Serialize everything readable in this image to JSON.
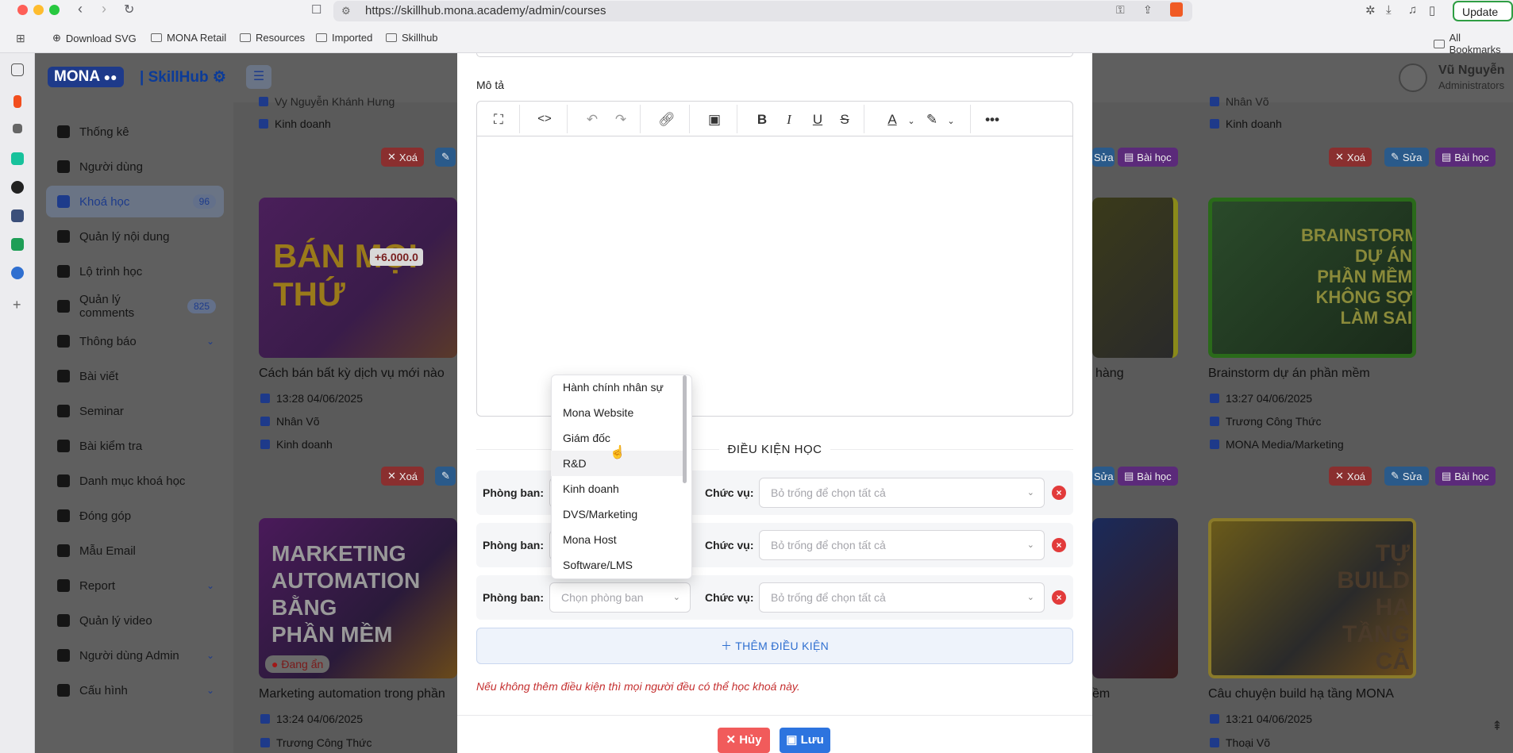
{
  "browser": {
    "url": "https://skillhub.mona.academy/admin/courses",
    "update_label": "Update",
    "bookmarks": [
      "Download SVG",
      "MONA Retail",
      "Resources",
      "Imported",
      "Skillhub"
    ],
    "all_bookmarks": "All Bookmarks"
  },
  "logo": {
    "brand": "MONA",
    "product": "SkillHub"
  },
  "user": {
    "name": "Vũ Nguyễn",
    "role": "Administrators"
  },
  "sidebar": {
    "items": [
      {
        "label": "Thống kê"
      },
      {
        "label": "Người dùng"
      },
      {
        "label": "Khoá học",
        "badge": "96",
        "active": true
      },
      {
        "label": "Quản lý nội dung"
      },
      {
        "label": "Lộ trình học"
      },
      {
        "label": "Quản lý comments",
        "badge": "825"
      },
      {
        "label": "Thông báo",
        "expandable": true
      },
      {
        "label": "Bài viết"
      },
      {
        "label": "Seminar"
      },
      {
        "label": "Bài kiểm tra"
      },
      {
        "label": "Danh mục khoá học"
      },
      {
        "label": "Đóng góp"
      },
      {
        "label": "Mẫu Email"
      },
      {
        "label": "Report",
        "expandable": true
      },
      {
        "label": "Quản lý video"
      },
      {
        "label": "Người dùng Admin",
        "expandable": true
      },
      {
        "label": "Cấu hình",
        "expandable": true
      }
    ]
  },
  "cards": {
    "top_left": {
      "author": "Vy Nguyễn Khánh Hưng",
      "dept": "Kinh doanh"
    },
    "top_right_a": {
      "author": "Nhân Võ",
      "dept": "Kinh doanh"
    },
    "left_1": {
      "title": "Cách bán bất kỳ dịch vụ mới nào",
      "time": "13:28 04/06/2025",
      "author": "Nhân Võ",
      "dept": "Kinh doanh",
      "thumb_text": "BÁN MỌI THỨ",
      "thumb_price": "+6.000.0"
    },
    "mid_1": {
      "title": "hàng"
    },
    "right_1": {
      "title": "Brainstorm dự án phần mềm",
      "time": "13:27 04/06/2025",
      "author": "Trương Công Thức",
      "dept": "MONA Media/Marketing",
      "thumb_text": "BRAINSTORM DỰ ÁN PHẦN MỀM KHÔNG SỢ LÀM SAI"
    },
    "left_2": {
      "title": "Marketing automation trong phần",
      "time": "13:24 04/06/2025",
      "author": "Trương Công Thức",
      "status": "Đang ẩn",
      "thumb_text": "MARKETING AUTOMATION BẰNG PHẦN MỀM"
    },
    "mid_2": {
      "title": "ềm"
    },
    "right_2": {
      "title": "Câu chuyện build hạ tầng MONA",
      "time": "13:21 04/06/2025",
      "author": "Thoại Võ",
      "thumb_text": "TỰ BUILD HẠ TẦNG CẢ CHỤC TỶ"
    },
    "buttons": {
      "delete": "Xoá",
      "edit": "Sửa",
      "lessons": "Bài học"
    }
  },
  "modal": {
    "description_label": "Mô tả",
    "section_title": "ĐIỀU KIỆN HỌC",
    "dept_label": "Phòng ban:",
    "position_label": "Chức vụ:",
    "position_placeholder": "Bỏ trống để chọn tất cả",
    "dept_placeholder": "Chọn phòng ban",
    "add_condition": "THÊM ĐIỀU KIỆN",
    "note": "Nếu không thêm điều kiện thì mọi người đều có thể học khoá này.",
    "cancel": "Hủy",
    "save": "Lưu"
  },
  "dropdown": {
    "options": [
      "Hành chính nhân sự",
      "Mona Website",
      "Giám đốc",
      "R&D",
      "Kinh doanh",
      "DVS/Marketing",
      "Mona Host",
      "Software/LMS"
    ],
    "hovered": "R&D"
  },
  "colors": {
    "brand": "#1e3a8a",
    "danger": "#f15b5b",
    "primary": "#2d74df"
  }
}
